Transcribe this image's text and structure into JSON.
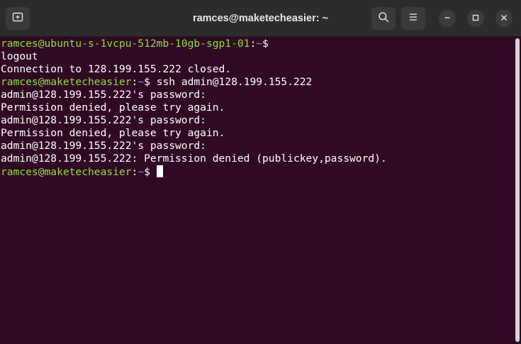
{
  "window": {
    "title": "ramces@maketecheasier: ~"
  },
  "toolbar": {
    "new_tab_icon": "new-tab-icon",
    "search_icon": "search-icon",
    "menu_icon": "hamburger-menu-icon"
  },
  "controls": {
    "minimize_icon": "minimize-icon",
    "maximize_icon": "maximize-icon",
    "close_icon": "close-icon"
  },
  "colors": {
    "background": "#300a24",
    "prompt_user": "#8ae234",
    "prompt_path": "#729fcf",
    "text": "#ffffff"
  },
  "terminal": {
    "lines": [
      {
        "type": "prompt",
        "user": "ramces@ubuntu-s-1vcpu-512mb-10gb-sgp1-01",
        "sep": ":",
        "path": "~",
        "symbol": "$",
        "cmd": ""
      },
      {
        "type": "output",
        "text": "logout"
      },
      {
        "type": "output",
        "text": "Connection to 128.199.155.222 closed."
      },
      {
        "type": "prompt",
        "user": "ramces@maketecheasier",
        "sep": ":",
        "path": "~",
        "symbol": "$",
        "cmd": " ssh admin@128.199.155.222"
      },
      {
        "type": "output",
        "text": "admin@128.199.155.222's password:"
      },
      {
        "type": "output",
        "text": "Permission denied, please try again."
      },
      {
        "type": "output",
        "text": "admin@128.199.155.222's password:"
      },
      {
        "type": "output",
        "text": "Permission denied, please try again."
      },
      {
        "type": "output",
        "text": "admin@128.199.155.222's password:"
      },
      {
        "type": "output",
        "text": "admin@128.199.155.222: Permission denied (publickey,password)."
      },
      {
        "type": "prompt",
        "user": "ramces@maketecheasier",
        "sep": ":",
        "path": "~",
        "symbol": "$",
        "cmd": " ",
        "cursor": true
      }
    ]
  }
}
